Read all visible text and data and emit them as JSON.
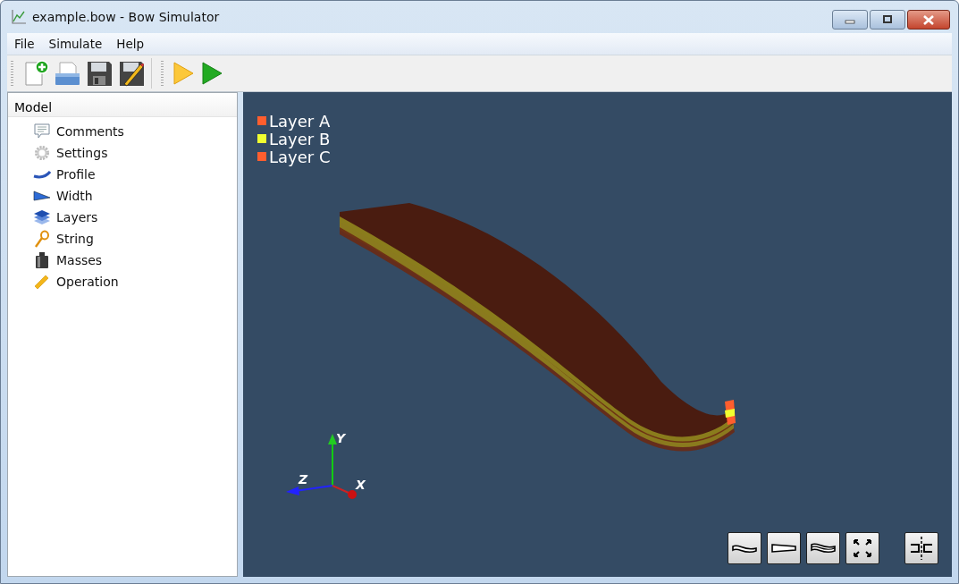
{
  "window": {
    "title": "example.bow - Bow Simulator"
  },
  "menu": [
    "File",
    "Simulate",
    "Help"
  ],
  "tree": {
    "label": "Model",
    "expanded": true,
    "children": [
      {
        "label": "Comments",
        "kind": "comments"
      },
      {
        "label": "Settings",
        "kind": "settings"
      },
      {
        "label": "Profile",
        "kind": "profile"
      },
      {
        "label": "Width",
        "kind": "width"
      },
      {
        "label": "Layers",
        "kind": "layers"
      },
      {
        "label": "String",
        "kind": "string"
      },
      {
        "label": "Masses",
        "kind": "masses"
      },
      {
        "label": "Operation",
        "kind": "operation"
      }
    ]
  },
  "legend": [
    {
      "label": "Layer A",
      "color": "#ff5e2e"
    },
    {
      "label": "Layer B",
      "color": "#f0ff30"
    },
    {
      "label": "Layer C",
      "color": "#ff5e2e"
    }
  ],
  "axes": [
    "X",
    "Y",
    "Z"
  ]
}
